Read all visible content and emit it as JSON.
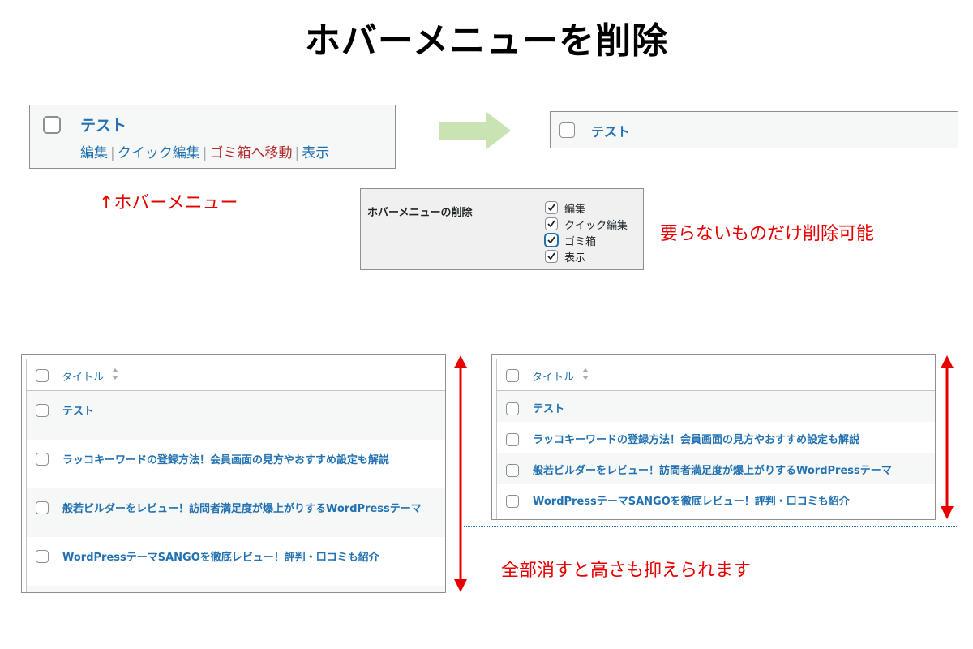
{
  "title": "ホバーメニューを削除",
  "row_before": {
    "title": "テスト",
    "actions": [
      "編集",
      "クイック編集",
      "ゴミ箱へ移動",
      "表示"
    ],
    "separator": "|"
  },
  "row_after": {
    "title": "テスト"
  },
  "hover_note": "↑ホバーメニュー",
  "settings": {
    "label": "ホバーメニューの削除",
    "options": [
      {
        "label": "編集",
        "checked": true
      },
      {
        "label": "クイック編集",
        "checked": true
      },
      {
        "label": "ゴミ箱",
        "checked": true
      },
      {
        "label": "表示",
        "checked": true
      }
    ]
  },
  "settings_note": "要らないものだけ削除可能",
  "list": {
    "column": "タイトル",
    "rows": [
      "テスト",
      "ラッコキーワードの登録方法！会員画面の見方やおすすめ設定も解説",
      "般若ビルダーをレビュー！訪問者満足度が爆上がりするWordPressテーマ",
      "WordPressテーマSANGOを徹底レビュー！評判・口コミも紹介"
    ]
  },
  "bottom_note": "全部消すと高さも抑えられます",
  "colors": {
    "link": "#2271b1",
    "trash": "#b32d2e",
    "annotation": "#e60000",
    "arrow_green": "#c9e3b3"
  }
}
